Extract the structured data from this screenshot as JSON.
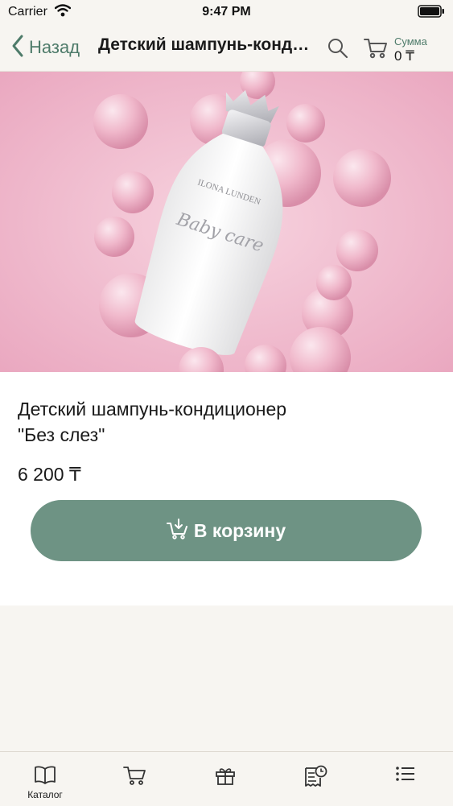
{
  "status_bar": {
    "carrier": "Carrier",
    "time": "9:47 PM"
  },
  "nav": {
    "back_label": "Назад",
    "title": "Детский шампунь-кондиционер \"Без слез\"",
    "cart_sum_label": "Сумма",
    "cart_sum_value": "0 ₸"
  },
  "product": {
    "image_alt": "ILONA LUNDEN Baby care",
    "brand_text": "ILONA LUNDEN",
    "script_text": "Baby care",
    "title": "Детский шампунь-кондиционер\n\"Без слез\"",
    "price": "6 200 ₸",
    "add_to_cart_label": "В корзину"
  },
  "tab_bar": {
    "items": [
      {
        "label": "Каталог",
        "icon": "book-icon"
      },
      {
        "label": "",
        "icon": "cart-icon"
      },
      {
        "label": "",
        "icon": "gift-icon"
      },
      {
        "label": "",
        "icon": "order-history-icon"
      },
      {
        "label": "",
        "icon": "list-icon"
      }
    ]
  },
  "colors": {
    "accent": "#4e7b6a",
    "button": "#6e9384",
    "background": "#f7f5f1"
  }
}
